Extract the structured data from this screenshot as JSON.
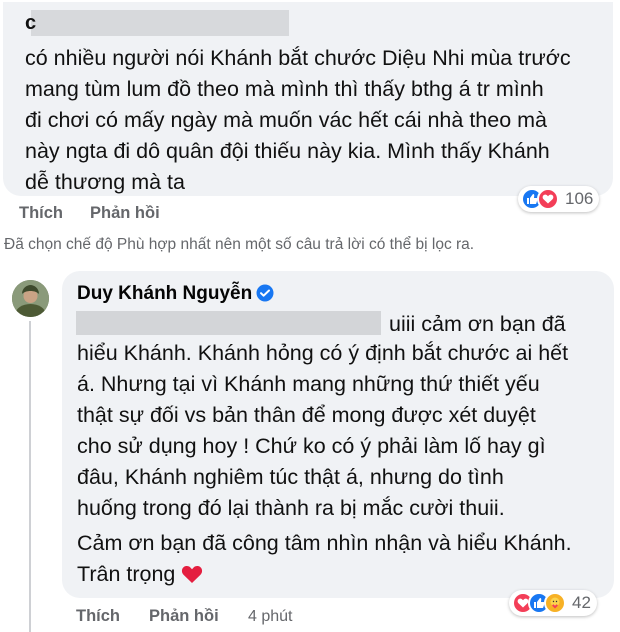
{
  "comment1": {
    "text": "có nhiều người nói Khánh bắt chước Diệu Nhi mùa trước\nmang tùm lum đồ theo mà mình thì thấy bthg á tr mình\nđi chơi có mấy ngày mà muốn vác hết cái nhà theo mà\nnày ngta đi dô quân đội thiếu này kia. Mình thấy Khánh\ndễ thương mà ta",
    "like_label": "Thích",
    "reply_label": "Phản hồi",
    "reaction_count": "106",
    "reactions": [
      "like-icon",
      "love-icon"
    ]
  },
  "filter_notice": "Đã chọn chế độ Phù hợp nhất nên một số câu trả lời có thể bị lọc ra.",
  "reply": {
    "author": "Duy Khánh Nguyễn",
    "verified_icon": "verified-badge-icon",
    "first_line": "uiii cảm ơn bạn đã",
    "text": "hiểu Khánh. Khánh hỏng có ý định bắt chước ai hết\ná. Nhưng tại vì Khánh mang những thứ thiết yếu\nthật sự đối vs bản thân để mong được xét duyệt\ncho sử dụng hoy ! Chứ ko có ý phải làm lố hay gì\nđâu, Khánh nghiêm túc thật á, nhưng do tình\nhuống trong đó lại thành ra bị mắc cười thuii.",
    "closing": "Cảm ơn bạn đã công tâm nhìn nhận và hiểu Khánh.\nTrân trọng",
    "heart_emoji": "❤️",
    "like_label": "Thích",
    "reply_label": "Phản hồi",
    "time": "4 phút",
    "reaction_count": "42",
    "reactions": [
      "love-icon",
      "like-icon",
      "care-icon"
    ]
  },
  "colors": {
    "bubble": "#f0f2f5",
    "like_blue": "#1877f2",
    "love_red": "#f33e58",
    "care_yellow": "#f7b125",
    "muted": "#65676b"
  }
}
